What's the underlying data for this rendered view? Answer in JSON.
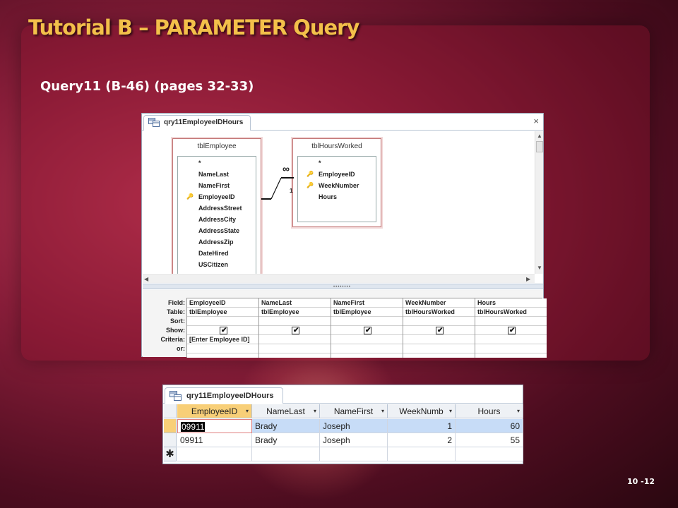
{
  "slide": {
    "title": "Tutorial B – PARAMETER Query",
    "subtitle": "Query11 (B-46) (pages 32-33)",
    "page_number": "10 -12"
  },
  "design": {
    "tab_label": "qry11EmployeeIDHours",
    "close_glyph": "×",
    "tables": {
      "employee": {
        "name": "tblEmployee",
        "fields": [
          "*",
          "NameLast",
          "NameFirst",
          "EmployeeID",
          "AddressStreet",
          "AddressCity",
          "AddressState",
          "AddressZip",
          "DateHired",
          "USCitizen"
        ],
        "key_fields": [
          "EmployeeID"
        ]
      },
      "hours": {
        "name": "tblHoursWorked",
        "fields": [
          "*",
          "EmployeeID",
          "WeekNumber",
          "Hours"
        ],
        "key_fields": [
          "EmployeeID",
          "WeekNumber"
        ]
      }
    },
    "relationship": {
      "one_label": "1",
      "many_label": "∞"
    },
    "grid": {
      "row_labels": [
        "Field:",
        "Table:",
        "Sort:",
        "Show:",
        "Criteria:",
        "or:"
      ],
      "columns": [
        {
          "field": "EmployeeID",
          "table": "tblEmployee",
          "show": true,
          "criteria": "[Enter Employee ID]"
        },
        {
          "field": "NameLast",
          "table": "tblEmployee",
          "show": true,
          "criteria": ""
        },
        {
          "field": "NameFirst",
          "table": "tblEmployee",
          "show": true,
          "criteria": ""
        },
        {
          "field": "WeekNumber",
          "table": "tblHoursWorked",
          "show": true,
          "criteria": ""
        },
        {
          "field": "Hours",
          "table": "tblHoursWorked",
          "show": true,
          "criteria": ""
        }
      ]
    }
  },
  "sheet": {
    "tab_label": "qry11EmployeeIDHours",
    "headers": [
      "EmployeeID",
      "NameLast",
      "NameFirst",
      "WeekNumb",
      "Hours"
    ],
    "rows": [
      [
        "09911",
        "Brady",
        "Joseph",
        "1",
        "60"
      ],
      [
        "09911",
        "Brady",
        "Joseph",
        "2",
        "55"
      ]
    ],
    "new_row_glyph": "✱"
  }
}
